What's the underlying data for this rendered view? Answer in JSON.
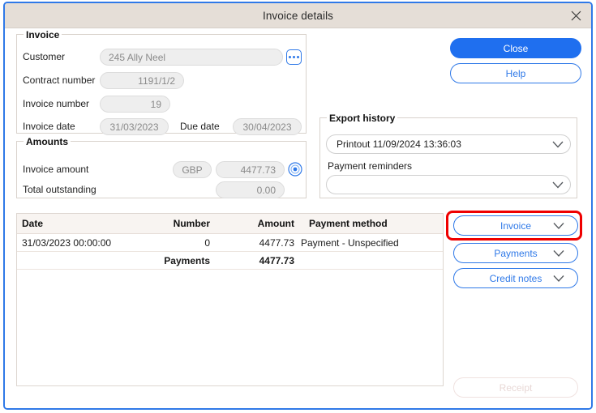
{
  "window": {
    "title": "Invoice details",
    "close_icon": "close-icon"
  },
  "invoice_group": {
    "title": "Invoice",
    "fields": {
      "customer_label": "Customer",
      "customer_value": "245 Ally Neel",
      "customer_picker_icon": "ellipsis-icon",
      "contract_label": "Contract number",
      "contract_value": "1191/1/2",
      "invoice_number_label": "Invoice number",
      "invoice_number_value": "19",
      "invoice_date_label": "Invoice date",
      "invoice_date_value": "31/03/2023",
      "due_date_label": "Due date",
      "due_date_value": "30/04/2023"
    }
  },
  "amounts_group": {
    "title": "Amounts",
    "fields": {
      "invoice_amount_label": "Invoice amount",
      "currency_value": "GBP",
      "invoice_amount_value": "4477.73",
      "currency_refresh_icon": "currency-refresh-icon",
      "total_outstanding_label": "Total outstanding",
      "total_outstanding_value": "0.00"
    }
  },
  "export_group": {
    "title": "Export history",
    "export_history_value": "Printout 11/09/2024 13:36:03",
    "payment_reminders_label": "Payment reminders",
    "payment_reminders_value": ""
  },
  "actions": {
    "close_label": "Close",
    "help_label": "Help",
    "invoice_label": "Invoice",
    "payments_label": "Payments",
    "credit_notes_label": "Credit notes",
    "receipt_label": "Receipt"
  },
  "table": {
    "columns": [
      "Date",
      "Number",
      "Amount",
      "Payment method"
    ],
    "rows": [
      {
        "date": "31/03/2023 00:00:00",
        "number": "0",
        "amount": "4477.73",
        "method": "Payment - Unspecified"
      }
    ],
    "summary": {
      "label": "Payments",
      "amount": "4477.73"
    }
  },
  "colors": {
    "accent": "#1f6fef",
    "accent_outline": "#2f79e8",
    "titlebar": "#e5ded7",
    "highlight": "#ef0000",
    "header_row": "#f8f4f1"
  }
}
